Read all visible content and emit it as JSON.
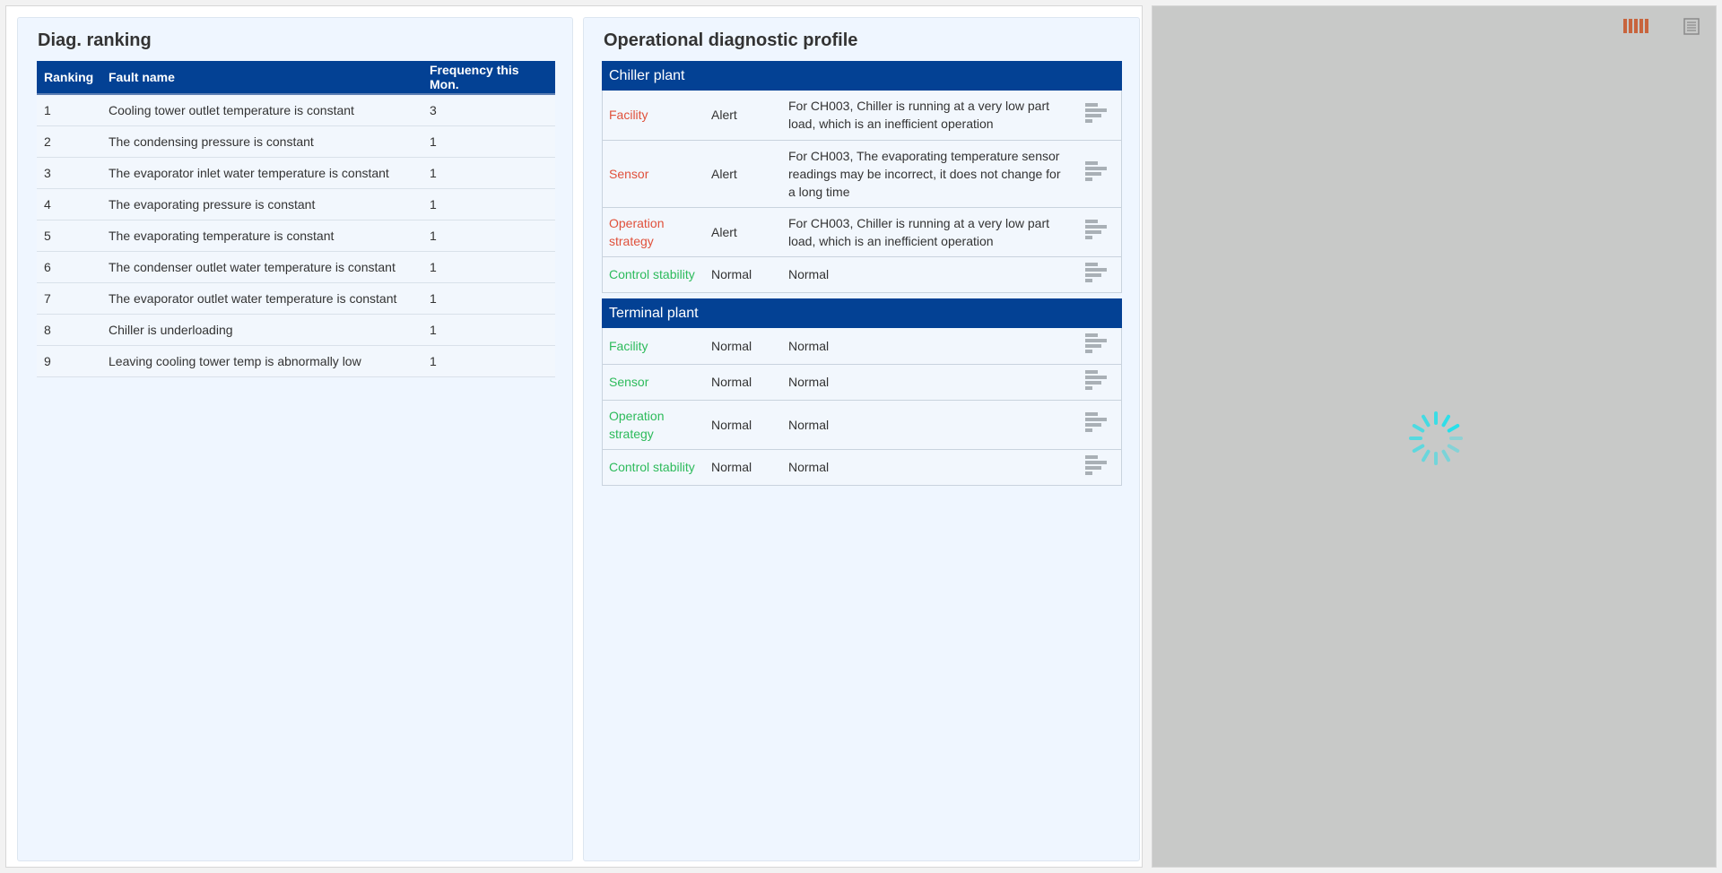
{
  "ranking": {
    "title": "Diag. ranking",
    "columns": [
      "Ranking",
      "Fault name",
      "Frequency this Mon."
    ],
    "rows": [
      {
        "rank": "1",
        "fault": "Cooling tower outlet temperature is constant",
        "freq": "3"
      },
      {
        "rank": "2",
        "fault": "The condensing pressure is constant",
        "freq": "1"
      },
      {
        "rank": "3",
        "fault": "The evaporator inlet water temperature is constant",
        "freq": "1"
      },
      {
        "rank": "4",
        "fault": "The evaporating pressure is constant",
        "freq": "1"
      },
      {
        "rank": "5",
        "fault": "The evaporating temperature is constant",
        "freq": "1"
      },
      {
        "rank": "6",
        "fault": "The condenser outlet water temperature is constant",
        "freq": "1"
      },
      {
        "rank": "7",
        "fault": "The evaporator outlet water temperature is constant",
        "freq": "1"
      },
      {
        "rank": "8",
        "fault": "Chiller is underloading",
        "freq": "1"
      },
      {
        "rank": "9",
        "fault": "Leaving cooling tower temp is abnormally low",
        "freq": "1"
      }
    ]
  },
  "profile": {
    "title": "Operational diagnostic profile",
    "chiller": {
      "header": "Chiller plant",
      "rows": [
        {
          "category": "Facility",
          "status": "Alert",
          "description": "For CH003, Chiller is running at a very low part load, which is an inefficient operation"
        },
        {
          "category": "Sensor",
          "status": "Alert",
          "description": "For CH003, The evaporating temperature sensor readings may be incorrect, it does not change for a long time"
        },
        {
          "category": "Operation strategy",
          "status": "Alert",
          "description": "For CH003, Chiller is running at a very low part load, which is an inefficient operation"
        },
        {
          "category": "Control stability",
          "status": "Normal",
          "description": "Normal"
        }
      ]
    },
    "terminal": {
      "header": "Terminal plant",
      "rows": [
        {
          "category": "Facility",
          "status": "Normal",
          "description": "Normal"
        },
        {
          "category": "Sensor",
          "status": "Normal",
          "description": "Normal"
        },
        {
          "category": "Operation strategy",
          "status": "Normal",
          "description": "Normal"
        },
        {
          "category": "Control stability",
          "status": "Normal",
          "description": "Normal"
        }
      ]
    }
  },
  "colors": {
    "header_bg": "#034194",
    "alert": "#e0513b",
    "normal": "#2dbb5b",
    "spinner": "#27e0ea",
    "toolbar_bars": "#c8643d"
  },
  "icons": {
    "detail": "bar-chart-icon",
    "toolbar_view": "columns-icon",
    "toolbar_data": "data-view-icon",
    "loading": "loading-spinner-icon"
  }
}
